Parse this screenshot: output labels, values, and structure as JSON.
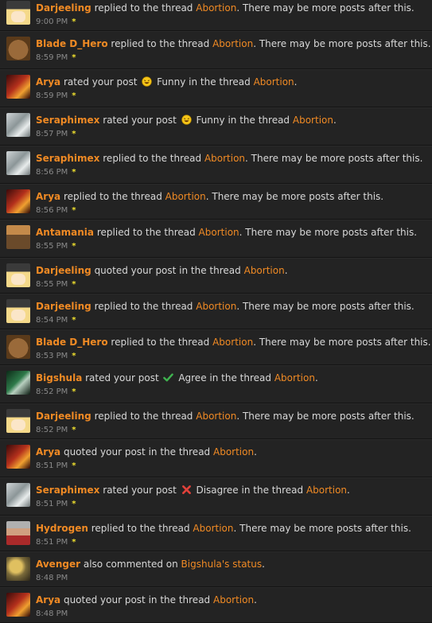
{
  "phrases": {
    "replied": "replied to the thread",
    "more": ". There may be more posts after this.",
    "rated": "rated your post",
    "in_thread": "in the thread",
    "quoted": "quoted your post in the thread",
    "also_commented": "also commented on",
    "period": "."
  },
  "thread": "Abortion",
  "reactions": {
    "funny": "Funny",
    "agree": "Agree",
    "disagree": "Disagree"
  },
  "alerts": [
    {
      "user": "Darjeeling",
      "time": "9:00 PM"
    },
    {
      "user": "Blade D_Hero",
      "time": "8:59 PM"
    },
    {
      "user": "Arya",
      "time": "8:59 PM"
    },
    {
      "user": "Seraphimex",
      "time": "8:57 PM"
    },
    {
      "user": "Seraphimex",
      "time": "8:56 PM"
    },
    {
      "user": "Arya",
      "time": "8:56 PM"
    },
    {
      "user": "Antamania",
      "time": "8:55 PM"
    },
    {
      "user": "Darjeeling",
      "time": "8:55 PM"
    },
    {
      "user": "Darjeeling",
      "time": "8:54 PM"
    },
    {
      "user": "Blade D_Hero",
      "time": "8:53 PM"
    },
    {
      "user": "Bigshula",
      "time": "8:52 PM"
    },
    {
      "user": "Darjeeling",
      "time": "8:52 PM"
    },
    {
      "user": "Arya",
      "time": "8:51 PM"
    },
    {
      "user": "Seraphimex",
      "time": "8:51 PM"
    },
    {
      "user": "Hydrogen",
      "time": "8:51 PM"
    },
    {
      "user": "Avenger",
      "time": "8:48 PM",
      "status_owner": "Bigshula's status"
    },
    {
      "user": "Arya",
      "time": "8:48 PM"
    }
  ],
  "colors": {
    "link": "#f08a24",
    "new_marker": "#f2e22e",
    "background": "#1f1f1f"
  },
  "new_marker_glyph": "*"
}
